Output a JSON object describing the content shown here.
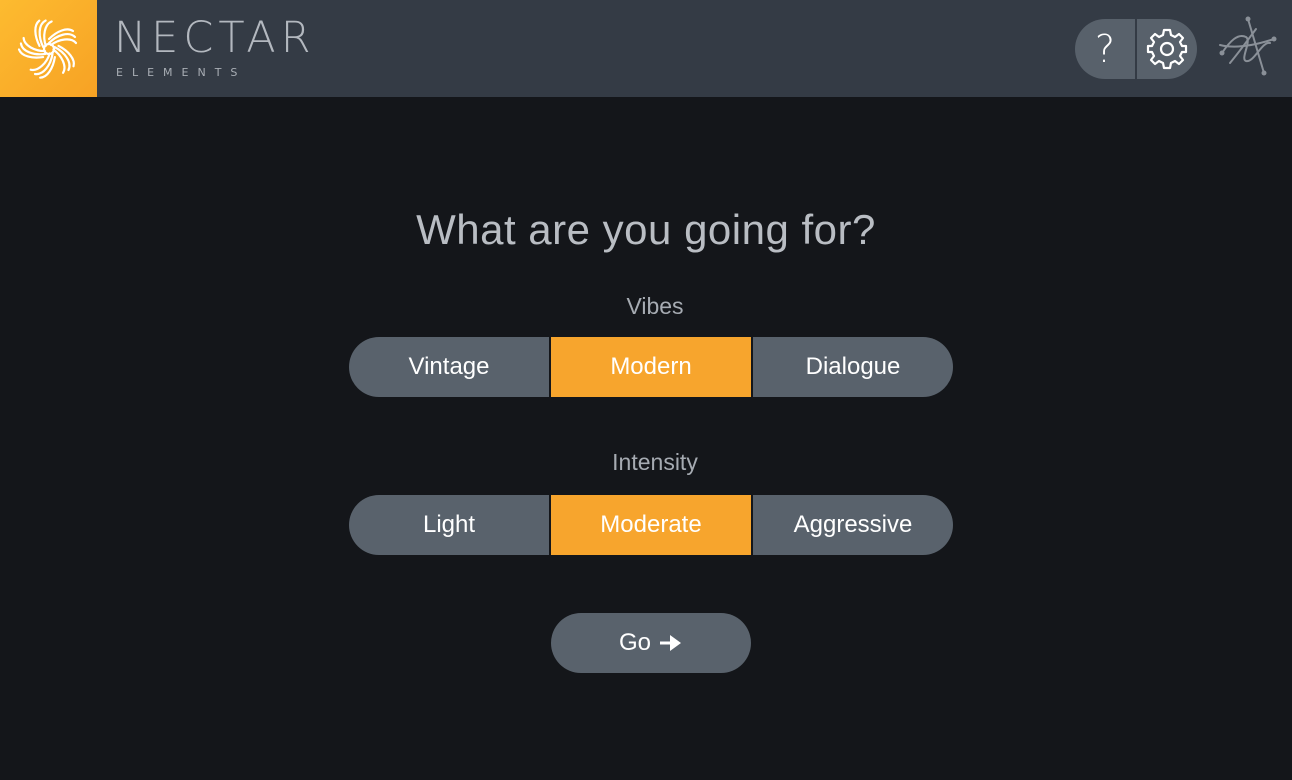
{
  "header": {
    "brand_title": "NECTAR",
    "brand_subtitle": "ELEMENTS",
    "help_glyph": "?",
    "icons": [
      "nectar-logo-icon",
      "help-icon",
      "gear-icon",
      "izotope-logo-icon"
    ]
  },
  "main": {
    "question": "What are you going for?",
    "vibes": {
      "label": "Vibes",
      "options": [
        "Vintage",
        "Modern",
        "Dialogue"
      ],
      "selected": "Modern"
    },
    "intensity": {
      "label": "Intensity",
      "options": [
        "Light",
        "Moderate",
        "Aggressive"
      ],
      "selected": "Moderate"
    },
    "go_label": "Go"
  },
  "colors": {
    "background": "#14161a",
    "header": "#343b45",
    "button": "#59626c",
    "accent": "#f7a52d",
    "text_muted": "#b9bdc3"
  }
}
